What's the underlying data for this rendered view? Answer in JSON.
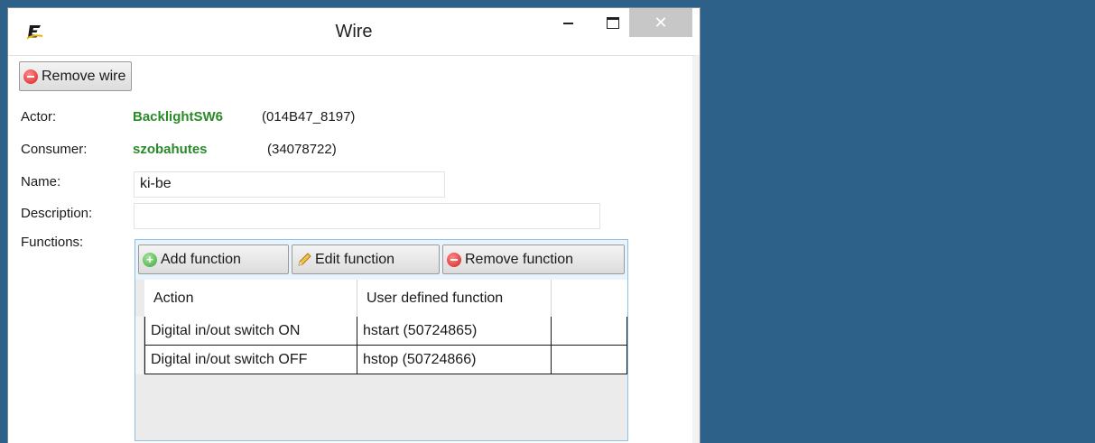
{
  "window": {
    "title": "Wire",
    "close_glyph": "✕"
  },
  "toolbar": {
    "remove_wire_label": "Remove wire"
  },
  "form": {
    "actor_label": "Actor:",
    "actor_name": "BacklightSW6",
    "actor_id": "(014B47_8197)",
    "consumer_label": "Consumer:",
    "consumer_name": "szobahutes",
    "consumer_id": "(34078722)",
    "name_label": "Name:",
    "name_value": "ki-be",
    "description_label": "Description:",
    "description_value": "",
    "functions_label": "Functions:"
  },
  "functions": {
    "add_label": "Add function",
    "edit_label": "Edit function",
    "remove_label": "Remove function",
    "columns": [
      "Action",
      "User defined function"
    ],
    "rows": [
      {
        "action": "Digital in/out switch ON",
        "function": "hstart (50724865)"
      },
      {
        "action": "Digital in/out switch OFF",
        "function": "hstop (50724866)"
      }
    ]
  },
  "colors": {
    "desktop": "#2e6189",
    "accent_green": "#2a8a2a",
    "panel_border": "#8ec0e8"
  },
  "icons": [
    "app-logo-icon",
    "minimize-icon",
    "maximize-icon",
    "close-icon",
    "remove-icon",
    "add-icon",
    "pencil-icon"
  ]
}
